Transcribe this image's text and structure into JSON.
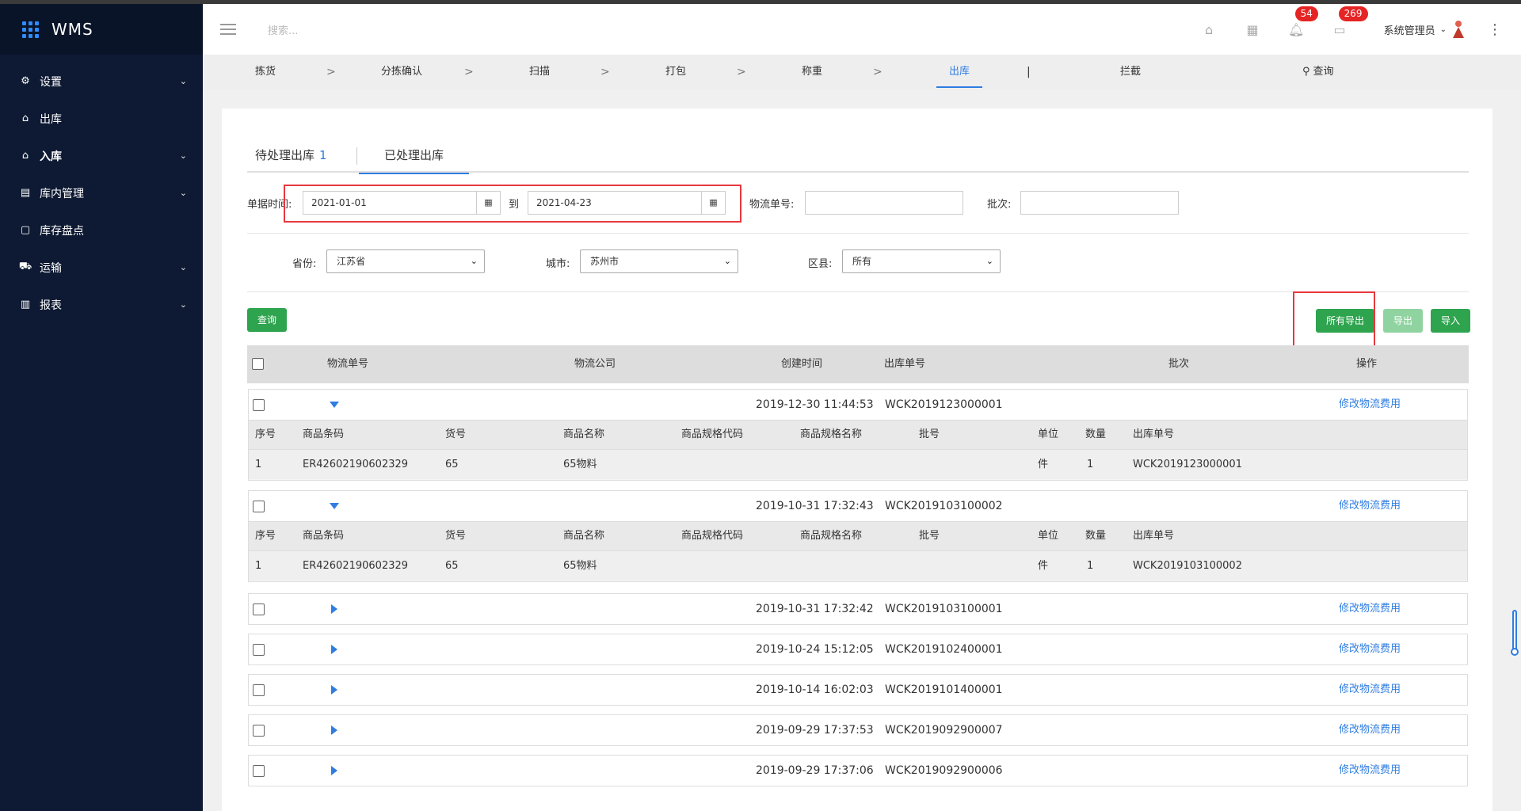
{
  "brand": {
    "name": "WMS"
  },
  "sidebar": {
    "items": [
      {
        "label": "设置",
        "icon": "gear-icon",
        "chevron": true
      },
      {
        "label": "出库",
        "icon": "outbound-icon",
        "chevron": false
      },
      {
        "label": "入库",
        "icon": "home-icon",
        "chevron": true
      },
      {
        "label": "库内管理",
        "icon": "warehouse-icon",
        "chevron": true
      },
      {
        "label": "库存盘点",
        "icon": "inventory-icon",
        "chevron": false
      },
      {
        "label": "运输",
        "icon": "truck-icon",
        "chevron": true
      },
      {
        "label": "报表",
        "icon": "chart-icon",
        "chevron": true
      }
    ]
  },
  "header": {
    "search_placeholder": "搜索...",
    "notifications_count": "54",
    "messages_count": "269",
    "user_name": "系统管理员"
  },
  "steps": {
    "items": [
      "拣货",
      "分拣确认",
      "扫描",
      "打包",
      "称重",
      "出库",
      "拦截"
    ],
    "active": "出库",
    "query_label": "查询"
  },
  "tabs": {
    "pending_label": "待处理出库",
    "pending_count": "1",
    "processed_label": "已处理出库"
  },
  "filters": {
    "date_label": "单据时间:",
    "date_from": "2021-01-01",
    "to_label": "到",
    "date_to": "2021-04-23",
    "tracking_label": "物流单号:",
    "batch_label": "批次:",
    "province_label": "省份:",
    "province_value": "江苏省",
    "city_label": "城市:",
    "city_value": "苏州市",
    "district_label": "区县:",
    "district_value": "所有"
  },
  "buttons": {
    "query": "查询",
    "export_all": "所有导出",
    "export": "导出",
    "import": "导入"
  },
  "table": {
    "headers": [
      "物流单号",
      "物流公司",
      "创建时间",
      "出库单号",
      "批次",
      "操作"
    ],
    "sub_headers": [
      "序号",
      "商品条码",
      "货号",
      "商品名称",
      "商品规格代码",
      "商品规格名称",
      "批号",
      "单位",
      "数量",
      "出库单号"
    ],
    "action_label": "修改物流费用",
    "rows": [
      {
        "created": "2019-12-30 11:44:53",
        "order": "WCK2019123000001",
        "expanded": true,
        "items": [
          {
            "no": "1",
            "barcode": "ER42602190602329",
            "sku": "65",
            "name": "65物料",
            "spec_code": "",
            "spec_name": "",
            "lot": "",
            "unit": "件",
            "qty": "1",
            "order": "WCK2019123000001"
          }
        ]
      },
      {
        "created": "2019-10-31 17:32:43",
        "order": "WCK2019103100002",
        "expanded": true,
        "items": [
          {
            "no": "1",
            "barcode": "ER42602190602329",
            "sku": "65",
            "name": "65物料",
            "spec_code": "",
            "spec_name": "",
            "lot": "",
            "unit": "件",
            "qty": "1",
            "order": "WCK2019103100002"
          }
        ]
      },
      {
        "created": "2019-10-31 17:32:42",
        "order": "WCK2019103100001",
        "expanded": false
      },
      {
        "created": "2019-10-24 15:12:05",
        "order": "WCK2019102400001",
        "expanded": false
      },
      {
        "created": "2019-10-14 16:02:03",
        "order": "WCK2019101400001",
        "expanded": false
      },
      {
        "created": "2019-09-29 17:37:53",
        "order": "WCK2019092900007",
        "expanded": false
      },
      {
        "created": "2019-09-29 17:37:06",
        "order": "WCK2019092900006",
        "expanded": false
      }
    ]
  },
  "colors": {
    "sidebar_bg": "#0e1a33",
    "accent": "#2f7de1",
    "button_green": "#2ea44f",
    "highlight_red": "#e8383d",
    "badge_red": "#e52424"
  }
}
